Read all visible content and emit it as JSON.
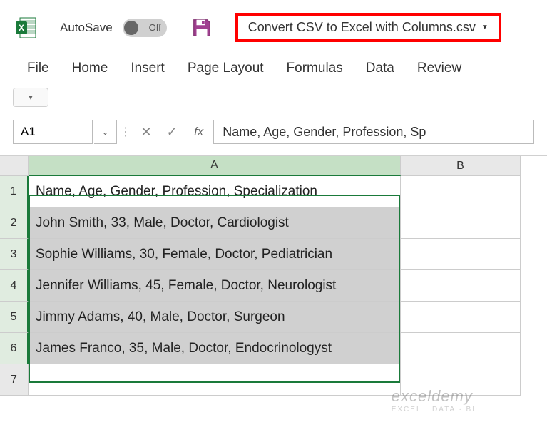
{
  "titlebar": {
    "autosave_label": "AutoSave",
    "toggle_state": "Off",
    "filename": "Convert CSV to Excel with Columns.csv"
  },
  "ribbon": {
    "tabs": [
      "File",
      "Home",
      "Insert",
      "Page Layout",
      "Formulas",
      "Data",
      "Review"
    ]
  },
  "namebox": {
    "value": "A1"
  },
  "formula": {
    "value": "Name, Age, Gender, Profession, Sp"
  },
  "columns": [
    "A",
    "B"
  ],
  "rows": [
    {
      "num": "1",
      "a": "Name, Age, Gender, Profession, Specialization",
      "active": true
    },
    {
      "num": "2",
      "a": "John Smith, 33, Male, Doctor, Cardiologist",
      "active": false
    },
    {
      "num": "3",
      "a": "Sophie Williams, 30, Female, Doctor, Pediatrician",
      "active": false
    },
    {
      "num": "4",
      "a": "Jennifer Williams,  45, Female, Doctor, Neurologist",
      "active": false
    },
    {
      "num": "5",
      "a": "Jimmy Adams, 40, Male, Doctor, Surgeon",
      "active": false
    },
    {
      "num": "6",
      "a": "James Franco, 35, Male, Doctor, Endocrinologyst",
      "active": false
    },
    {
      "num": "7",
      "a": "",
      "active": false,
      "empty": true
    }
  ],
  "watermark": {
    "main": "exceldemy",
    "sub": "EXCEL · DATA · BI"
  }
}
